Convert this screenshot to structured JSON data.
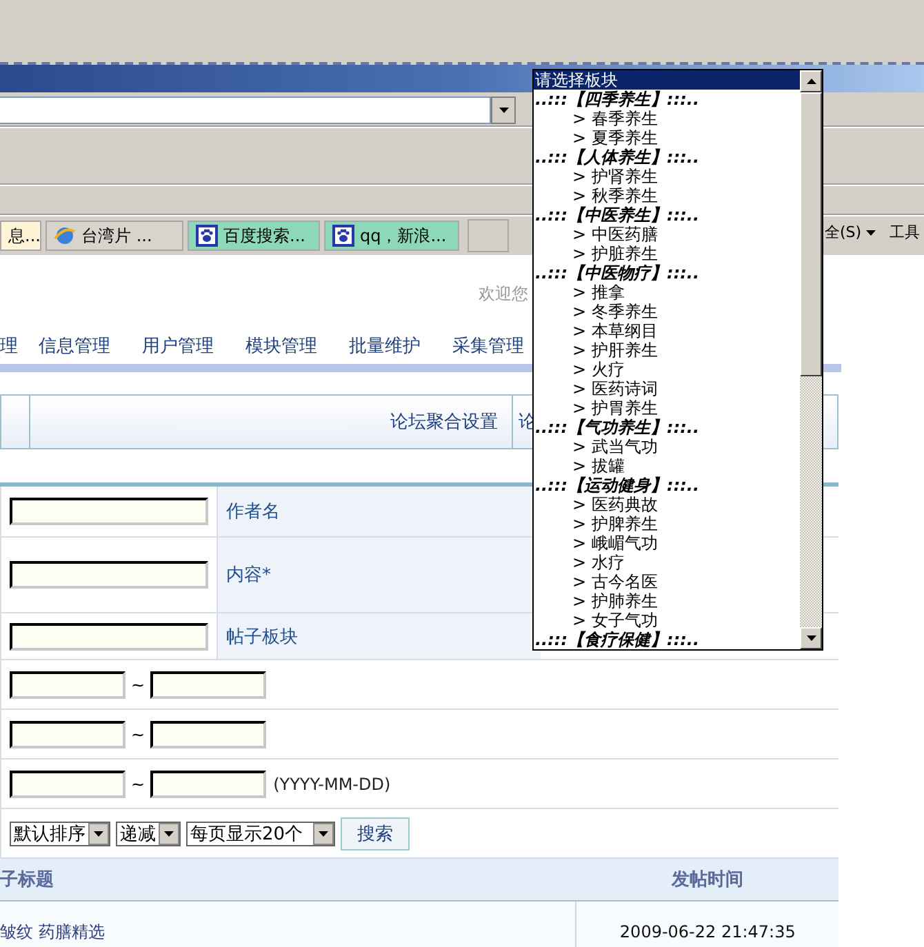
{
  "browser": {
    "taskbar_tabs": [
      {
        "label": "息...",
        "kind": "plain"
      },
      {
        "label": "台湾片 ...",
        "kind": "ie"
      },
      {
        "label": "百度搜索...",
        "kind": "paw"
      },
      {
        "label": "qq，新浪...",
        "kind": "paw"
      }
    ],
    "toolbar": [
      {
        "label": "全(S)",
        "menu": true
      },
      {
        "label": "工具",
        "menu": false
      }
    ]
  },
  "header": {
    "welcome": "欢迎您"
  },
  "nav": [
    "理",
    "信息管理",
    "用户管理",
    "模块管理",
    "批量维护",
    "采集管理"
  ],
  "subtabs": [
    "论坛聚合设置",
    "论"
  ],
  "form": {
    "rows": [
      {
        "kind": "field",
        "label": "作者名"
      },
      {
        "kind": "field",
        "label": "内容*"
      },
      {
        "kind": "field",
        "label": "帖子板块"
      },
      {
        "kind": "range",
        "separator": "~"
      },
      {
        "kind": "range",
        "separator": "~"
      },
      {
        "kind": "range",
        "separator": "~",
        "hint": "(YYYY-MM-DD)"
      }
    ],
    "selects": [
      "默认排序",
      "递减",
      "每页显示20个"
    ],
    "search_button": "搜索"
  },
  "table": {
    "columns": [
      "子标题",
      "发帖时间"
    ],
    "rows": [
      {
        "title": "皱纹 药膳精选",
        "time": "2009-06-22 21:47:35"
      }
    ]
  },
  "dropdown": {
    "options": [
      {
        "kind": "placeholder",
        "label": "请选择板块",
        "selected": true
      },
      {
        "kind": "group",
        "label": "..:::【四季养生】:::..",
        "selected": false
      },
      {
        "kind": "option",
        "label": "> 春季养生",
        "selected": false
      },
      {
        "kind": "option",
        "label": "> 夏季养生",
        "selected": false
      },
      {
        "kind": "group",
        "label": "..:::【人体养生】:::..",
        "selected": false
      },
      {
        "kind": "option",
        "label": "> 护肾养生",
        "selected": false
      },
      {
        "kind": "option",
        "label": "> 秋季养生",
        "selected": false
      },
      {
        "kind": "group",
        "label": "..:::【中医养生】:::..",
        "selected": false
      },
      {
        "kind": "option",
        "label": "> 中医药膳",
        "selected": false
      },
      {
        "kind": "option",
        "label": "> 护脏养生",
        "selected": false
      },
      {
        "kind": "group",
        "label": "..:::【中医物疗】:::..",
        "selected": false
      },
      {
        "kind": "option",
        "label": "> 推拿",
        "selected": false
      },
      {
        "kind": "option",
        "label": "> 冬季养生",
        "selected": false
      },
      {
        "kind": "option",
        "label": "> 本草纲目",
        "selected": false
      },
      {
        "kind": "option",
        "label": "> 护肝养生",
        "selected": false
      },
      {
        "kind": "option",
        "label": "> 火疗",
        "selected": false
      },
      {
        "kind": "option",
        "label": "> 医药诗词",
        "selected": false
      },
      {
        "kind": "option",
        "label": "> 护胃养生",
        "selected": false
      },
      {
        "kind": "group",
        "label": "..:::【气功养生】:::..",
        "selected": false
      },
      {
        "kind": "option",
        "label": "> 武当气功",
        "selected": false
      },
      {
        "kind": "option",
        "label": "> 拔罐",
        "selected": false
      },
      {
        "kind": "group",
        "label": "..:::【运动健身】:::..",
        "selected": false
      },
      {
        "kind": "option",
        "label": "> 医药典故",
        "selected": false
      },
      {
        "kind": "option",
        "label": "> 护脾养生",
        "selected": false
      },
      {
        "kind": "option",
        "label": "> 峨嵋气功",
        "selected": false
      },
      {
        "kind": "option",
        "label": "> 水疗",
        "selected": false
      },
      {
        "kind": "option",
        "label": "> 古今名医",
        "selected": false
      },
      {
        "kind": "option",
        "label": "> 护肺养生",
        "selected": false
      },
      {
        "kind": "option",
        "label": "> 女子气功",
        "selected": false
      },
      {
        "kind": "group",
        "label": "..:::【食疗保健】:::..",
        "selected": false
      }
    ]
  }
}
